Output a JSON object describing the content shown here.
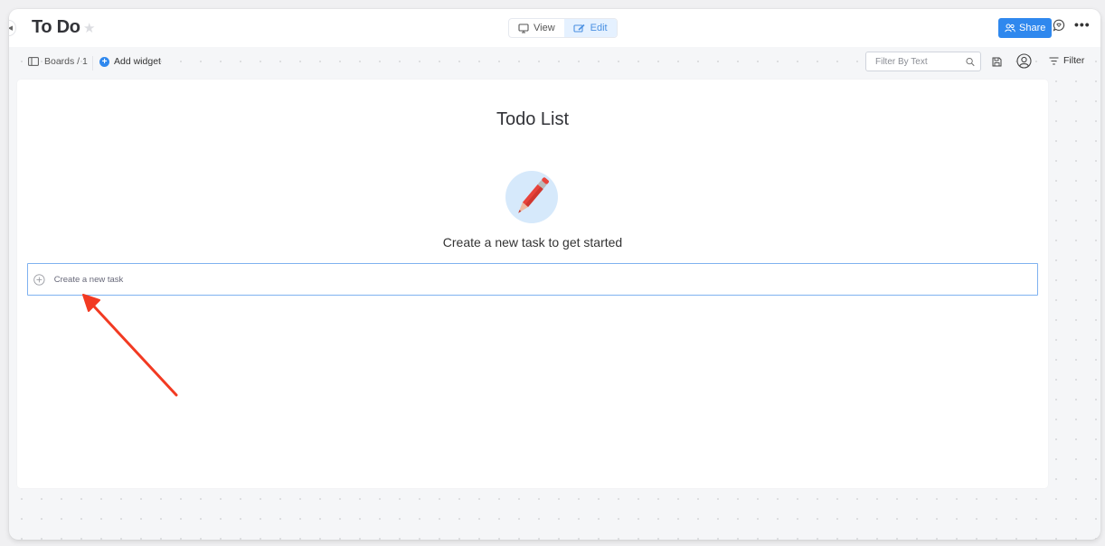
{
  "header": {
    "board_title": "To Do",
    "star_icon": "star-icon",
    "mode_toggle": {
      "view_label": "View",
      "edit_label": "Edit",
      "active": "Edit"
    },
    "share_label": "Share",
    "chat_icon": "chat-bubble-icon",
    "more_icon": "more-horizontal-icon"
  },
  "toolbar": {
    "boards_crumb": "Boards / 1",
    "add_widget_label": "Add widget",
    "filter_placeholder": "Filter By Text",
    "filter_value": "",
    "filter_label": "Filter"
  },
  "widget": {
    "title": "Todo List",
    "illustration": "pencil-icon",
    "empty_message": "Create a new task to get started",
    "new_task_placeholder": "Create a new task"
  },
  "annotation": {
    "type": "arrow",
    "color": "#f23a22",
    "points_to": "new-task-input"
  },
  "colors": {
    "accent": "#2f88ee",
    "edit_active_bg": "#e5f1ff",
    "input_focus_border": "#7fb2f0",
    "illustration_bg": "#d6e9fb",
    "pencil_red": "#e8433b"
  }
}
